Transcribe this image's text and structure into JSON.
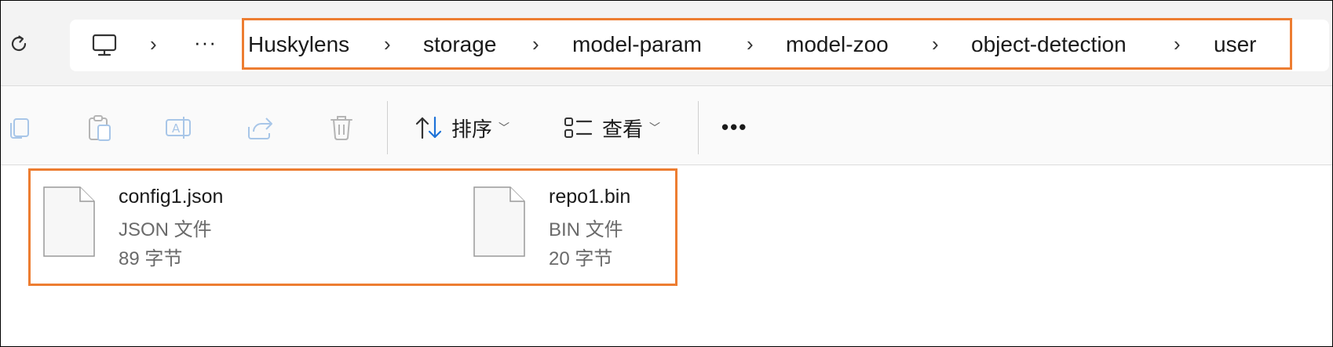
{
  "address": {
    "breadcrumbs": [
      "Huskylens",
      "storage",
      "model-param",
      "model-zoo",
      "object-detection",
      "user"
    ],
    "overflow_label": "···"
  },
  "toolbar": {
    "sort_label": "排序",
    "view_label": "查看",
    "more_label": "•••"
  },
  "files": [
    {
      "name": "config1.json",
      "type": "JSON 文件",
      "size": "89 字节"
    },
    {
      "name": "repo1.bin",
      "type": "BIN 文件",
      "size": "20 字节"
    }
  ],
  "colors": {
    "highlight": "#ed7d31",
    "accent_blue": "#1e73d8"
  },
  "icons": {
    "refresh": "refresh-icon",
    "pc": "this-pc-icon",
    "copy": "copy-icon",
    "paste": "paste-icon",
    "rename": "rename-icon",
    "share": "share-icon",
    "delete": "delete-icon",
    "sort": "sort-icon",
    "view": "view-icon",
    "file": "file-icon"
  }
}
